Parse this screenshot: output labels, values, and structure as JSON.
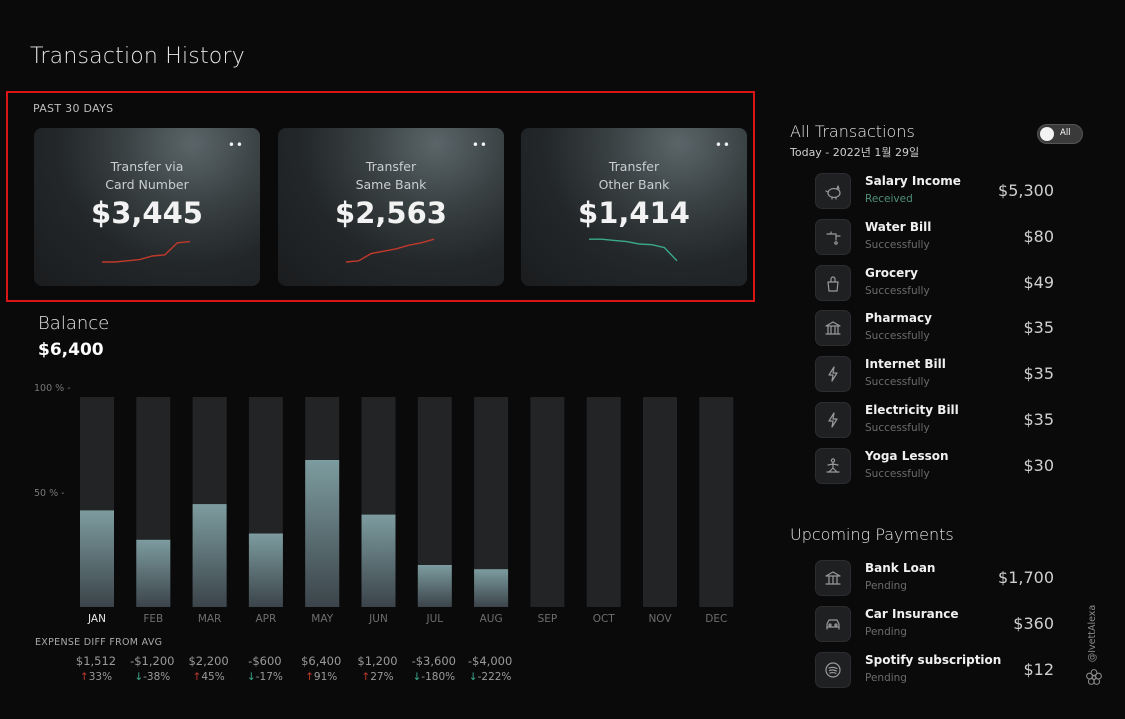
{
  "page": {
    "title": "Transaction History"
  },
  "summary": {
    "period_label": "PAST 30 DAYS",
    "cards": [
      {
        "label_line1": "Transfer via",
        "label_line2": "Card Number",
        "amount": "$3,445",
        "trend": "up",
        "spark": [
          0,
          0,
          0.05,
          0.1,
          0.25,
          0.3,
          0.8,
          0.85
        ],
        "color": "#c0392b",
        "more_icon": "••"
      },
      {
        "label_line1": "Transfer",
        "label_line2": "Same Bank",
        "amount": "$2,563",
        "trend": "up",
        "spark": [
          0,
          0.05,
          0.35,
          0.45,
          0.55,
          0.7,
          0.8,
          0.95
        ],
        "color": "#c0392b",
        "more_icon": "••"
      },
      {
        "label_line1": "Transfer",
        "label_line2": "Other Bank",
        "amount": "$1,414",
        "trend": "down",
        "spark": [
          0.95,
          0.95,
          0.9,
          0.85,
          0.75,
          0.72,
          0.6,
          0.05
        ],
        "color": "#3aaa8a",
        "more_icon": "••"
      }
    ]
  },
  "balance": {
    "label": "Balance",
    "value": "$6,400"
  },
  "chart_data": {
    "type": "bar",
    "categories": [
      "JAN",
      "FEB",
      "MAR",
      "APR",
      "MAY",
      "JUN",
      "JUL",
      "AUG",
      "SEP",
      "OCT",
      "NOV",
      "DEC"
    ],
    "values": [
      46,
      32,
      49,
      35,
      70,
      44,
      20,
      18,
      null,
      null,
      null,
      null
    ],
    "ylim": [
      0,
      100
    ],
    "yticks": [
      {
        "value": 100,
        "label": "100 % -"
      },
      {
        "value": 50,
        "label": "50 % -"
      }
    ],
    "title": "",
    "xlabel": "",
    "ylabel": "",
    "grid": false,
    "active_category": "JAN"
  },
  "expense_diff": {
    "title": "EXPENSE DIFF FROM AVG",
    "items": [
      {
        "value": "$1,512",
        "pct": "33%",
        "dir": "up"
      },
      {
        "value": "-$1,200",
        "pct": "-38%",
        "dir": "down"
      },
      {
        "value": "$2,200",
        "pct": "45%",
        "dir": "up"
      },
      {
        "value": "-$600",
        "pct": "-17%",
        "dir": "down"
      },
      {
        "value": "$6,400",
        "pct": "91%",
        "dir": "up"
      },
      {
        "value": "$1,200",
        "pct": "27%",
        "dir": "up"
      },
      {
        "value": "-$3,600",
        "pct": "-180%",
        "dir": "down"
      },
      {
        "value": "-$4,000",
        "pct": "-222%",
        "dir": "down"
      }
    ]
  },
  "all_transactions": {
    "title": "All Transactions",
    "subtitle": "Today - 2022년 1월 29일",
    "toggle_label": "All",
    "items": [
      {
        "name": "Salary Income",
        "status": "Received",
        "amount": "$5,300",
        "icon": "piggy-bank-icon"
      },
      {
        "name": "Water Bill",
        "status": "Successfully",
        "amount": "$80",
        "icon": "faucet-icon"
      },
      {
        "name": "Grocery",
        "status": "Successfully",
        "amount": "$49",
        "icon": "grocery-bag-icon"
      },
      {
        "name": "Pharmacy",
        "status": "Successfully",
        "amount": "$35",
        "icon": "building-icon"
      },
      {
        "name": "Internet Bill",
        "status": "Successfully",
        "amount": "$35",
        "icon": "lightning-icon"
      },
      {
        "name": "Electricity Bill",
        "status": "Successfully",
        "amount": "$35",
        "icon": "lightning-icon"
      },
      {
        "name": "Yoga Lesson",
        "status": "Successfully",
        "amount": "$30",
        "icon": "yoga-icon"
      }
    ]
  },
  "upcoming_payments": {
    "title": "Upcoming Payments",
    "items": [
      {
        "name": "Bank Loan",
        "status": "Pending",
        "amount": "$1,700",
        "icon": "bank-icon"
      },
      {
        "name": "Car Insurance",
        "status": "Pending",
        "amount": "$360",
        "icon": "car-icon"
      },
      {
        "name": "Spotify subscription",
        "status": "Pending",
        "amount": "$12",
        "icon": "spotify-icon"
      }
    ]
  },
  "watermark": {
    "text": "@IvettAlexa"
  }
}
